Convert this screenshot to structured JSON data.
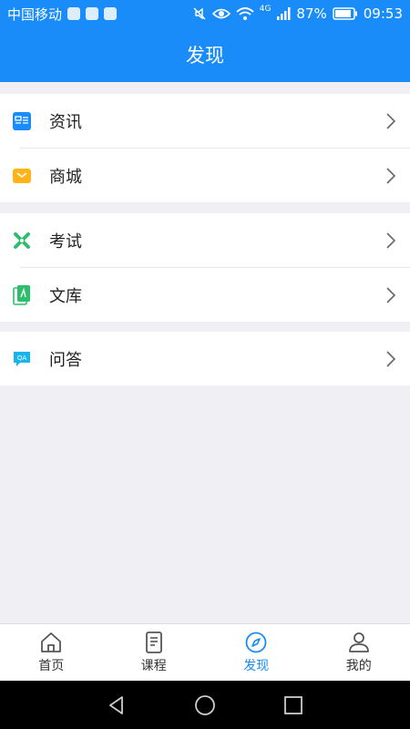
{
  "status_bar": {
    "carrier": "中国移动",
    "network": "4G",
    "battery_percent": "87%",
    "time": "09:53"
  },
  "header": {
    "title": "发现"
  },
  "sections": [
    {
      "items": [
        {
          "label": "资讯",
          "icon": "news-icon"
        },
        {
          "label": "商城",
          "icon": "shop-icon"
        }
      ]
    },
    {
      "items": [
        {
          "label": "考试",
          "icon": "exam-icon"
        },
        {
          "label": "文库",
          "icon": "library-icon"
        }
      ]
    },
    {
      "items": [
        {
          "label": "问答",
          "icon": "qa-icon"
        }
      ]
    }
  ],
  "tabbar": {
    "tabs": [
      {
        "label": "首页",
        "icon": "home-icon",
        "active": false
      },
      {
        "label": "课程",
        "icon": "course-icon",
        "active": false
      },
      {
        "label": "发现",
        "icon": "compass-icon",
        "active": true
      },
      {
        "label": "我的",
        "icon": "user-icon",
        "active": false
      }
    ]
  },
  "colors": {
    "accent": "#1a8cf9",
    "shop": "#ffb31a",
    "exam": "#2dbe6c",
    "library": "#2dbe6c",
    "qa": "#18b4ee"
  }
}
